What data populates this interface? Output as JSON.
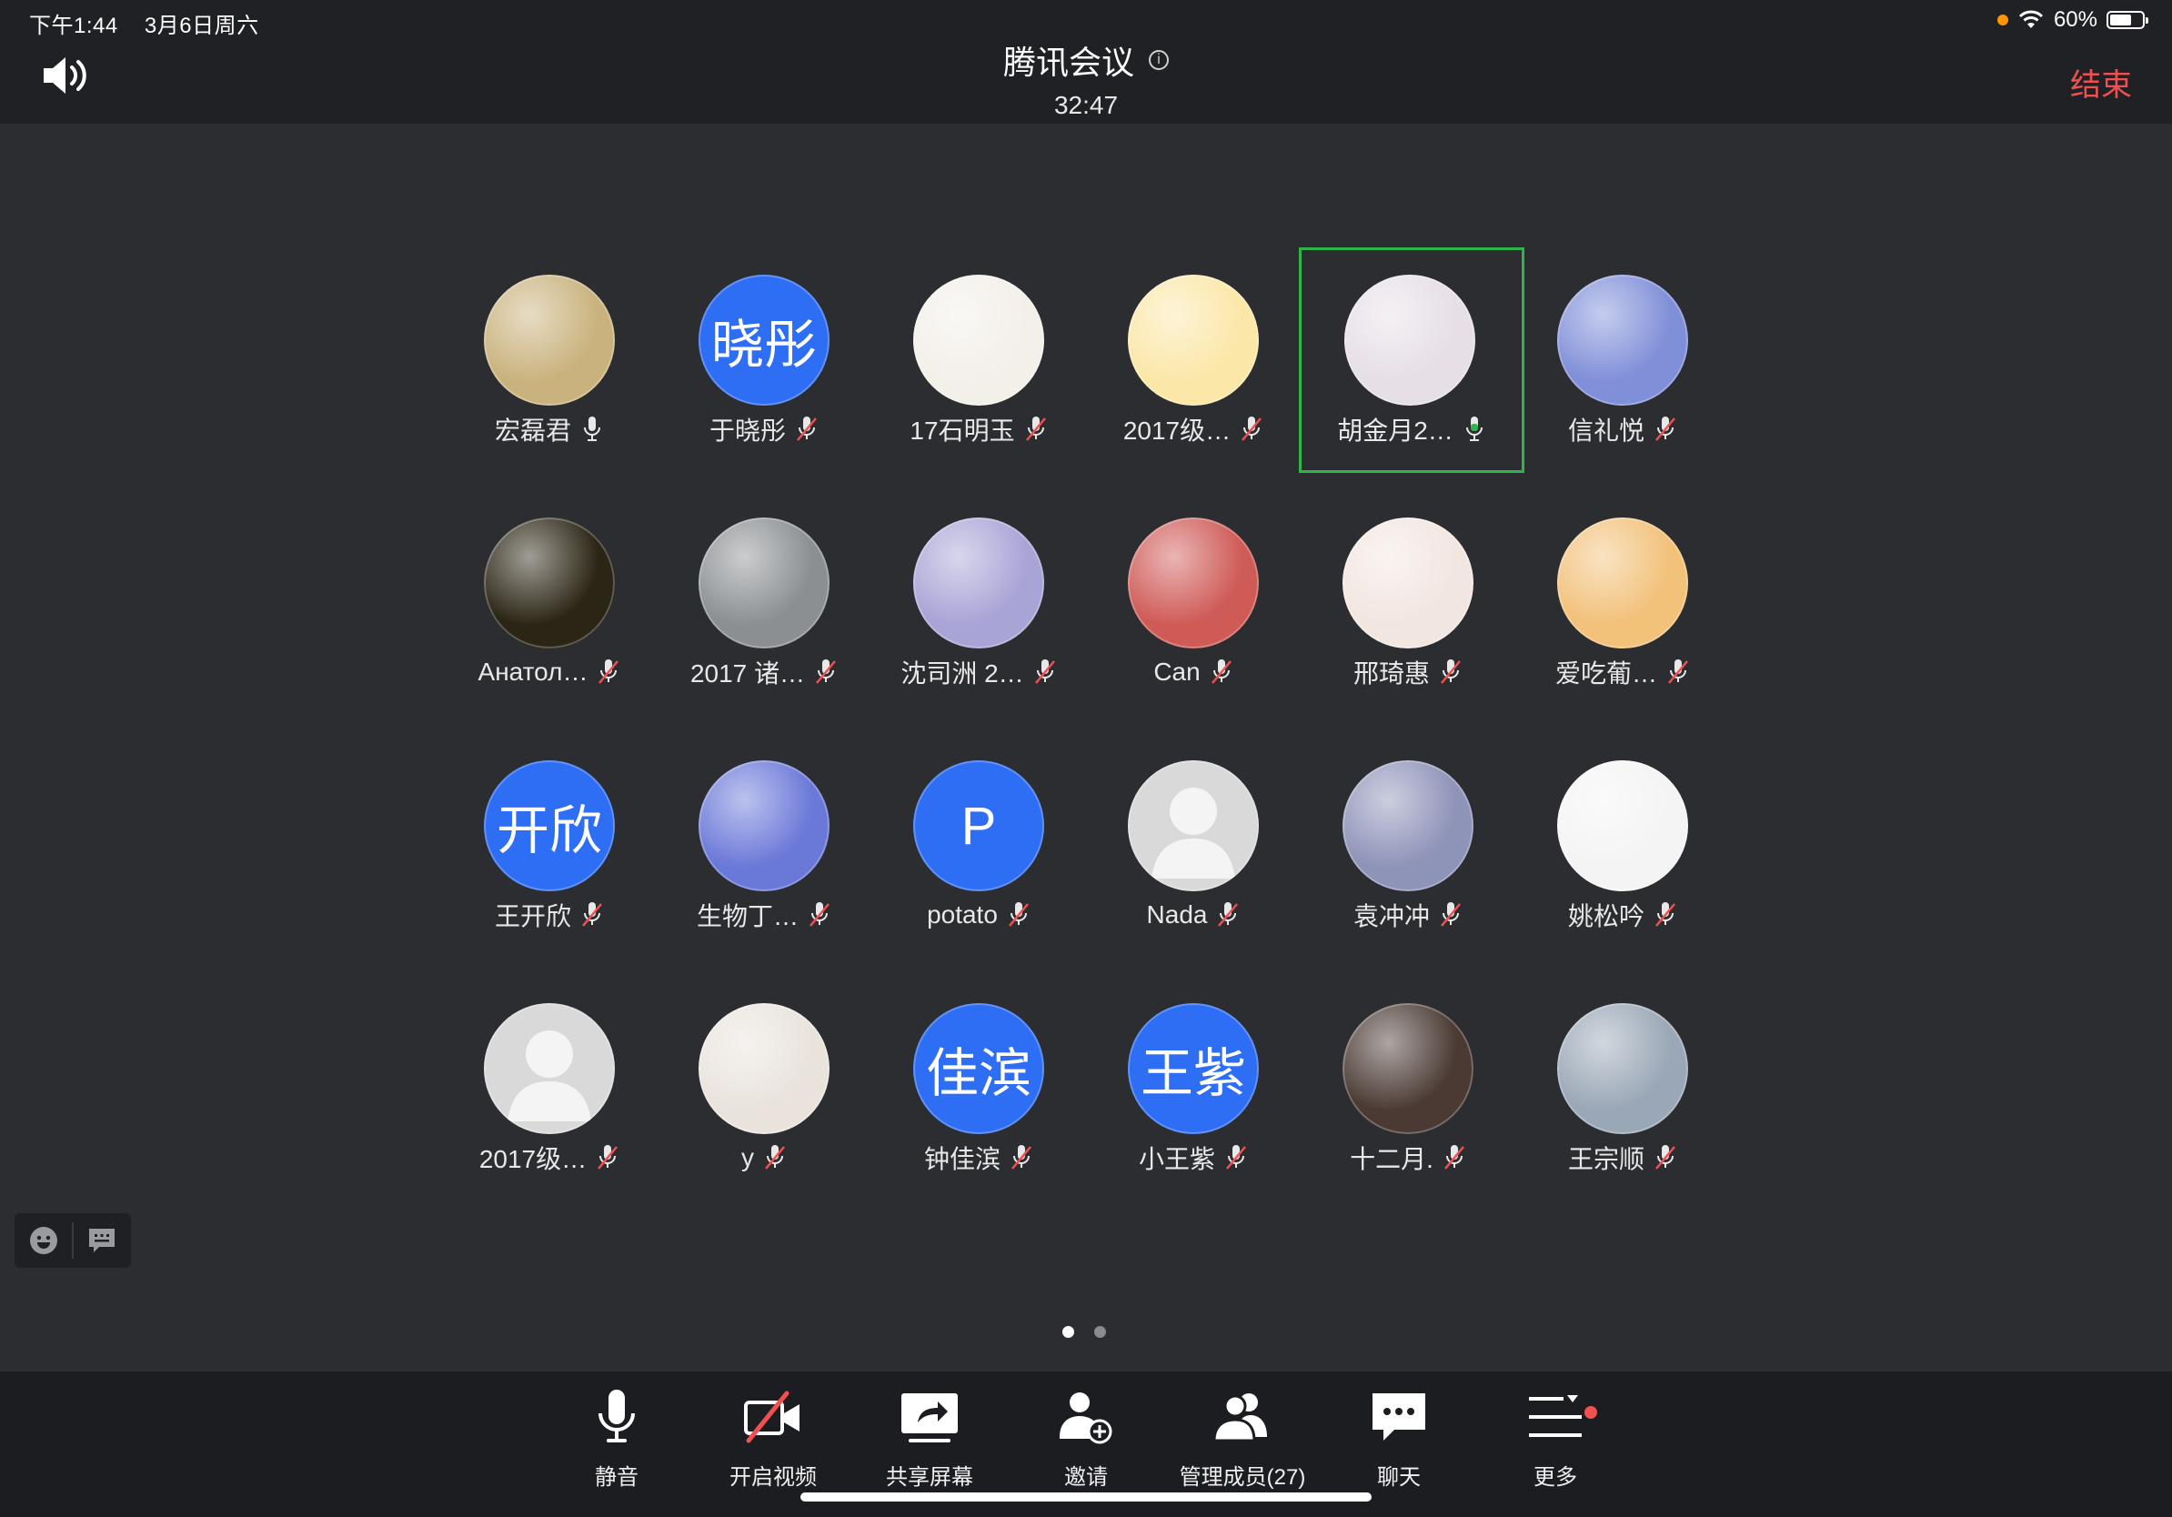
{
  "status_bar": {
    "time": "下午1:44",
    "date": "3月6日周六",
    "battery": "60%"
  },
  "header": {
    "title": "腾讯会议",
    "timer": "32:47",
    "end_label": "结束"
  },
  "participants": [
    {
      "name": "宏磊君",
      "avatar": "photo",
      "bg": "#c9b27d",
      "mic": "on"
    },
    {
      "name": "于晓彤",
      "avatar": "text",
      "avatar_text": "晓彤",
      "mic": "muted"
    },
    {
      "name": "17石明玉",
      "avatar": "photo",
      "bg": "#f3efe9",
      "mic": "muted"
    },
    {
      "name": "2017级…",
      "avatar": "photo",
      "bg": "#fbe7a8",
      "mic": "muted"
    },
    {
      "name": "胡金月2…",
      "avatar": "photo",
      "bg": "#e6dfe6",
      "mic": "speaking",
      "active": true
    },
    {
      "name": "信礼悦",
      "avatar": "photo",
      "bg": "#7f8fd8",
      "mic": "muted"
    },
    {
      "name": "Анатол…",
      "avatar": "photo",
      "bg": "#2b2515",
      "mic": "muted"
    },
    {
      "name": "2017 诸…",
      "avatar": "photo",
      "bg": "#8b8f92",
      "mic": "muted"
    },
    {
      "name": "沈司洲 2…",
      "avatar": "photo",
      "bg": "#a9a4d6",
      "mic": "muted"
    },
    {
      "name": "Can",
      "avatar": "photo",
      "bg": "#cf5b57",
      "mic": "muted"
    },
    {
      "name": "邢琦惠",
      "avatar": "photo",
      "bg": "#f2e6e0",
      "mic": "muted"
    },
    {
      "name": "爱吃葡…",
      "avatar": "photo",
      "bg": "#f2c17a",
      "mic": "muted"
    },
    {
      "name": "王开欣",
      "avatar": "text",
      "avatar_text": "开欣",
      "mic": "muted"
    },
    {
      "name": "生物丁…",
      "avatar": "photo",
      "bg": "#6a78d8",
      "mic": "muted"
    },
    {
      "name": "potato",
      "avatar": "text",
      "avatar_text": "P",
      "mic": "muted"
    },
    {
      "name": "Nada",
      "avatar": "default",
      "mic": "muted"
    },
    {
      "name": "袁冲冲",
      "avatar": "photo",
      "bg": "#8e93b8",
      "mic": "muted"
    },
    {
      "name": "姚松吟",
      "avatar": "photo",
      "bg": "#f4f4f4",
      "mic": "muted"
    },
    {
      "name": "2017级…",
      "avatar": "default",
      "mic": "muted"
    },
    {
      "name": "y",
      "avatar": "photo",
      "bg": "#e9e3dc",
      "mic": "muted"
    },
    {
      "name": "钟佳滨",
      "avatar": "text",
      "avatar_text": "佳滨",
      "mic": "muted"
    },
    {
      "name": "小王紫",
      "avatar": "text",
      "avatar_text": "王紫",
      "mic": "muted"
    },
    {
      "name": "十二月.",
      "avatar": "photo",
      "bg": "#4a3a33",
      "mic": "muted"
    },
    {
      "name": "王宗顺",
      "avatar": "photo",
      "bg": "#9aa7b6",
      "mic": "muted"
    }
  ],
  "toolbar": {
    "mute": "静音",
    "video": "开启视频",
    "share": "共享屏幕",
    "invite": "邀请",
    "members": "管理成员(27)",
    "chat": "聊天",
    "more": "更多"
  },
  "colors": {
    "accent": "#2e6ef4",
    "end": "#f05050",
    "active_border": "#2fb64a"
  }
}
